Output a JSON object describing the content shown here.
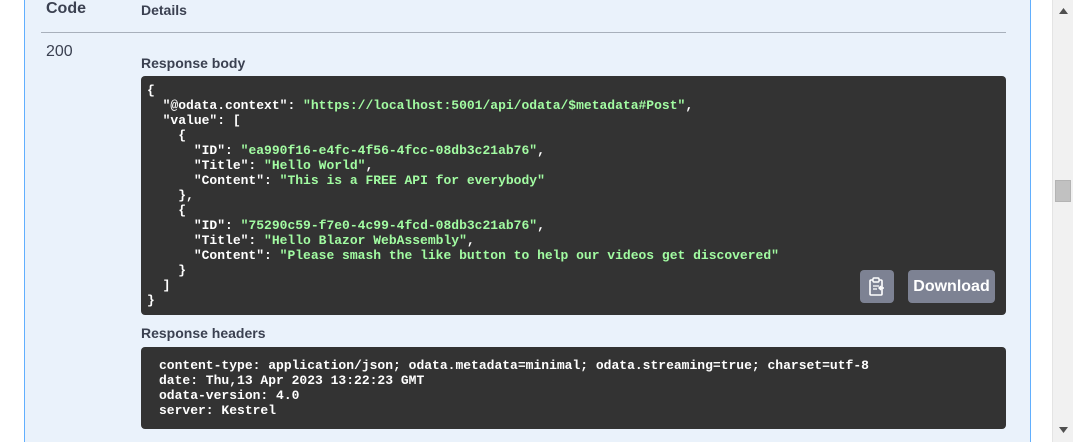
{
  "table_header": {
    "code_label": "Code",
    "details_label": "Details"
  },
  "response": {
    "status_code": "200",
    "body_label": "Response body",
    "headers_label": "Response headers",
    "body": {
      "open_brace": "{",
      "context_key": "\"@odata.context\"",
      "context_value": "\"https://localhost:5001/api/odata/$metadata#Post\"",
      "value_key": "\"value\"",
      "items": [
        {
          "id": "\"ea990f16-e4fc-4f56-4fcc-08db3c21ab76\"",
          "title": "\"Hello World\"",
          "content": "\"This is a FREE API for everybody\""
        },
        {
          "id": "\"75290c59-f7e0-4c99-4fcd-08db3c21ab76\"",
          "title": "\"Hello Blazor WebAssembly\"",
          "content": "\"Please smash the like button to help our videos get discovered\""
        }
      ],
      "id_key": "\"ID\"",
      "title_key": "\"Title\"",
      "content_key": "\"Content\""
    },
    "headers": [
      "content-type: application/json; odata.metadata=minimal; odata.streaming=true; charset=utf-8",
      "date: Thu,13 Apr 2023 13:22:23 GMT",
      "odata-version: 4.0",
      "server: Kestrel"
    ],
    "download_label": "Download",
    "copy_icon": "clipboard-copy-icon"
  },
  "colors": {
    "panel_background": "#eaf2fb",
    "panel_border": "#61affe",
    "code_background": "#333333",
    "string_color": "#a2fca2",
    "button_background": "#7d8293"
  }
}
